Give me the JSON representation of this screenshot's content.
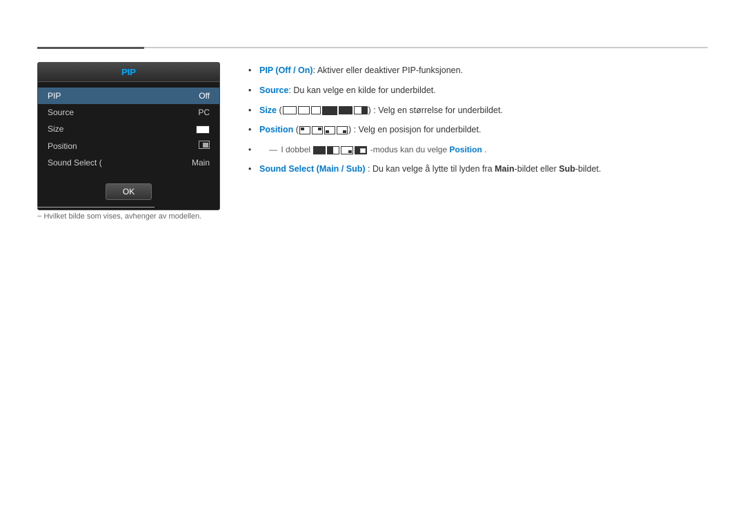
{
  "page": {
    "divider": true
  },
  "pip_panel": {
    "title": "PIP",
    "menu_items": [
      {
        "label": "PIP",
        "value": "Off",
        "active": true
      },
      {
        "label": "Source",
        "value": "PC",
        "active": false
      },
      {
        "label": "Size",
        "value": "",
        "active": false
      },
      {
        "label": "Position",
        "value": "",
        "active": false
      },
      {
        "label": "Sound Select",
        "value": "Main",
        "active": false
      }
    ],
    "ok_button": "OK"
  },
  "footnote": {
    "text": "− Hvilket bilde som vises, avhenger av modellen."
  },
  "content": {
    "bullets": [
      {
        "id": 1,
        "text_parts": [
          {
            "text": "PIP (",
            "style": "bold-blue"
          },
          {
            "text": "Off",
            "style": "bold-blue"
          },
          {
            "text": " / ",
            "style": "bold-blue"
          },
          {
            "text": "On",
            "style": "bold-blue"
          },
          {
            "text": "): Aktiver eller deaktiver PIP-funksjonen.",
            "style": "normal"
          }
        ]
      },
      {
        "id": 2,
        "text_parts": [
          {
            "text": "Source",
            "style": "bold-blue"
          },
          {
            "text": ": Du kan velge en kilde for underbildet.",
            "style": "normal"
          }
        ]
      },
      {
        "id": 3,
        "text_parts": [
          {
            "text": "Size",
            "style": "bold-blue"
          },
          {
            "text": ": Velg en størrelse for underbildet.",
            "style": "normal"
          }
        ],
        "has_size_icons": true
      },
      {
        "id": 4,
        "text_parts": [
          {
            "text": "Position",
            "style": "bold-blue"
          },
          {
            "text": ": Velg en posisjon for underbildet.",
            "style": "normal"
          }
        ],
        "has_position_icons": true
      },
      {
        "id": 5,
        "sub_text": "I dobbel",
        "sub_suffix": "-modus kan du velge",
        "position_bold": "Position",
        "period": ".",
        "has_double_icons": true
      },
      {
        "id": 6,
        "text_parts": [
          {
            "text": "Sound Select (",
            "style": "bold-blue"
          },
          {
            "text": "Main",
            "style": "bold-blue"
          },
          {
            "text": " / ",
            "style": "bold-blue"
          },
          {
            "text": "Sub",
            "style": "bold-blue"
          },
          {
            "text": "): Du kan velge å lytte til lyden fra ",
            "style": "normal"
          },
          {
            "text": "Main",
            "style": "bold-black"
          },
          {
            "text": "-bildet eller ",
            "style": "normal"
          },
          {
            "text": "Sub",
            "style": "bold-black"
          },
          {
            "text": "-bildet.",
            "style": "normal"
          }
        ]
      }
    ]
  }
}
